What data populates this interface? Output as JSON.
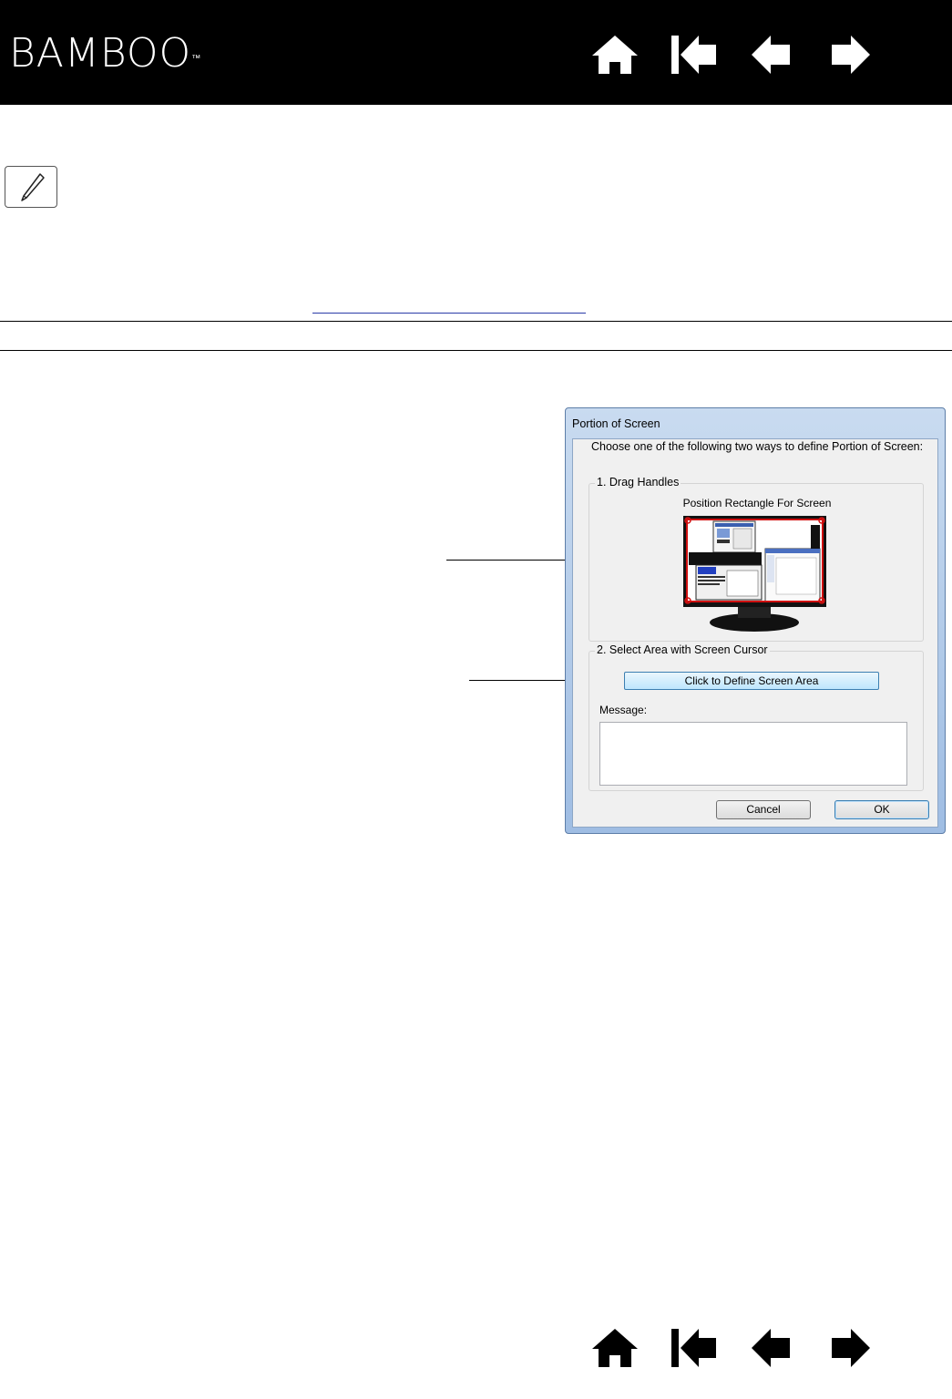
{
  "header": {
    "logo_text": "BAMBOO",
    "logo_mark": "™",
    "nav_icons": [
      "home-icon",
      "first-page-icon",
      "previous-page-icon",
      "next-page-icon"
    ]
  },
  "note_icon": "pen-icon",
  "dialog": {
    "title": "Portion of Screen",
    "intro": "Choose one of the following two ways to define Portion of Screen:",
    "group1": {
      "label": "1. Drag Handles",
      "caption": "Position Rectangle For Screen"
    },
    "group2": {
      "label": "2. Select Area with Screen Cursor",
      "define_button": "Click to Define Screen Area",
      "message_label": "Message:",
      "message_value": ""
    },
    "cancel_button": "Cancel",
    "ok_button": "OK"
  },
  "colors": {
    "header_bg": "#000000",
    "handle_red": "#d01010",
    "link_blue": "#2a3ca8"
  }
}
